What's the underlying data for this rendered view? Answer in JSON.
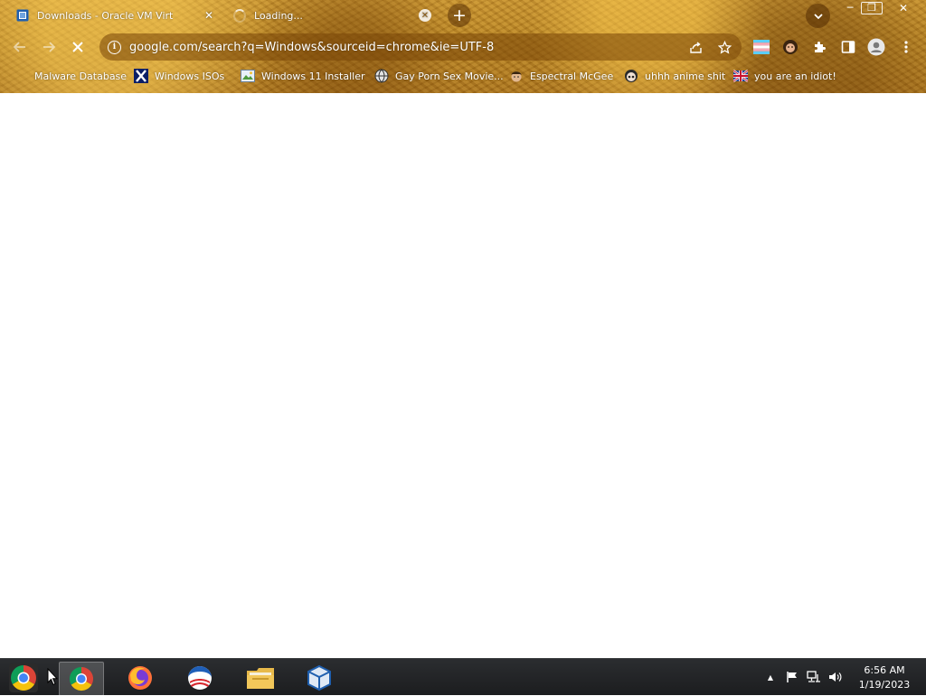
{
  "tabs": [
    {
      "title": "Downloads - Oracle VM VirtualBox",
      "favicon": "virtualbox-icon",
      "close": "✕"
    },
    {
      "title": "Loading...",
      "favicon": "loading-spinner",
      "close": "✕"
    }
  ],
  "new_tab_glyph": "+",
  "window_controls": {
    "minimize": "─",
    "maximize": "❐",
    "close": "✕"
  },
  "address_bar": {
    "url": "google.com/search?q=Windows&sourceid=chrome&ie=UTF-8",
    "info_glyph": "i"
  },
  "bookmarks": [
    {
      "label": "Malware Database",
      "icon": "none"
    },
    {
      "label": "Windows ISOs",
      "icon": "x-logo-icon"
    },
    {
      "label": "Windows 11 Installer",
      "icon": "image-icon"
    },
    {
      "label": "Gay Porn Sex Movie...",
      "icon": "globe-icon"
    },
    {
      "label": "Espectral McGee",
      "icon": "face-icon"
    },
    {
      "label": "uhhh anime shit",
      "icon": "anime-face-icon"
    },
    {
      "label": "you are an idiot!",
      "icon": "uk-flag-icon"
    }
  ],
  "taskbar": {
    "apps": [
      "start-button",
      "chrome",
      "firefox",
      "internet-explorer",
      "file-explorer",
      "virtualbox"
    ],
    "clock": {
      "time": "6:56 AM",
      "date": "1/19/2023"
    },
    "tray_arrow": "▲"
  },
  "colors": {
    "toolbar_wood": "#b98322",
    "taskbar": "#1f2022",
    "page_background": "#ffffff"
  }
}
